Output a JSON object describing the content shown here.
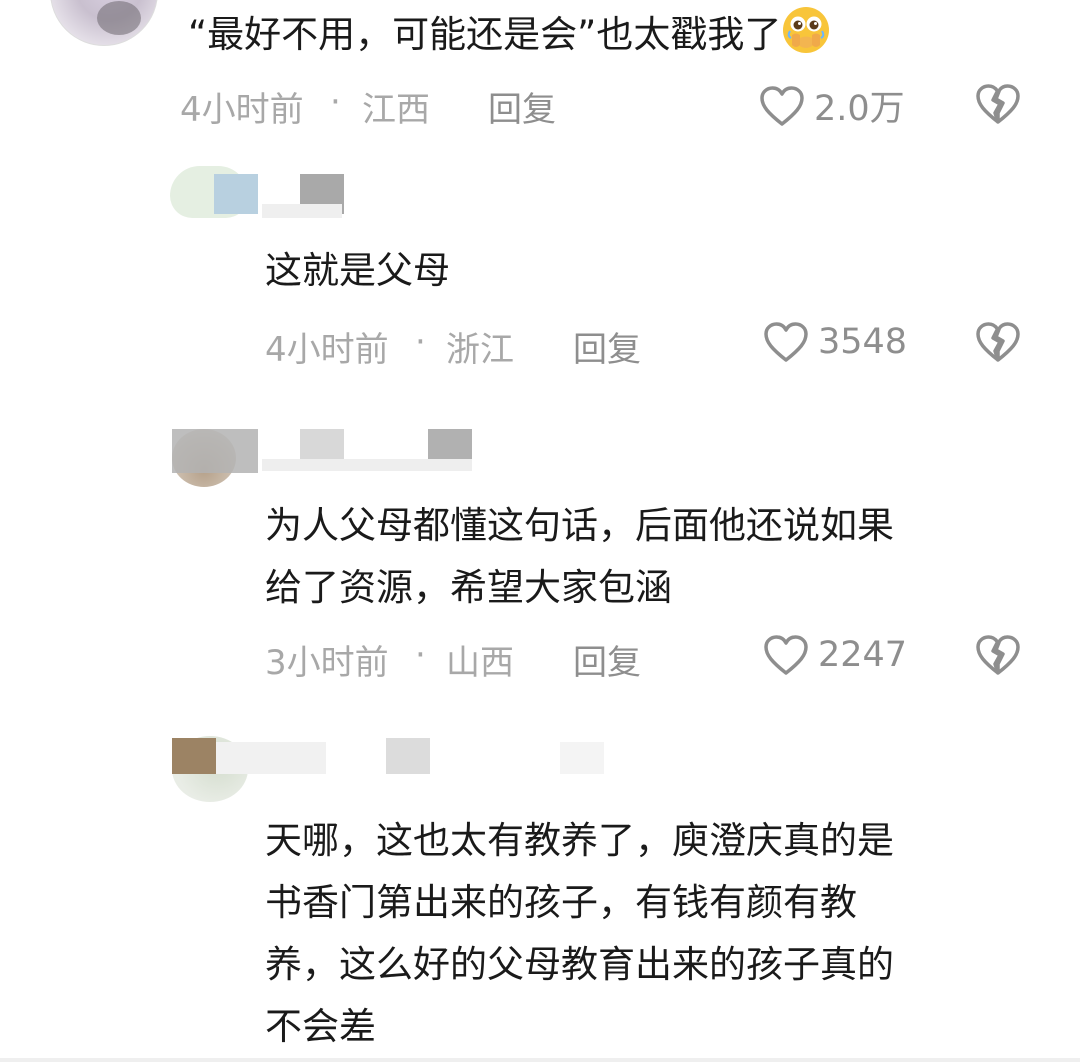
{
  "comments": [
    {
      "text": "“最好不用，可能还是会”也太戳我了",
      "emoji": "covering-mouth-teary-emoji",
      "time": "4小时前",
      "separator": "·",
      "location": "江西",
      "reply_label": "回复",
      "likes": "2.0万"
    },
    {
      "text": "这就是父母",
      "time": "4小时前",
      "separator": "·",
      "location": "浙江",
      "reply_label": "回复",
      "likes": "3548"
    },
    {
      "lines": [
        "为人父母都懂这句话，后面他还说如果",
        "给了资源，希望大家包涵"
      ],
      "time": "3小时前",
      "separator": "·",
      "location": "山西",
      "reply_label": "回复",
      "likes": "2247"
    },
    {
      "lines": [
        "天哪，这也太有教养了，庾澄庆真的是",
        "书香门第出来的孩子，有钱有颜有教",
        "养，这么好的父母教育出来的孩子真的",
        "不会差"
      ]
    }
  ],
  "icons": {
    "like": "heart-outline-icon",
    "dislike": "broken-heart-icon"
  },
  "colors": {
    "meta_text": "#a8a8a8",
    "icon_gray": "#8e8e8e",
    "body_text": "#1a1a1a"
  }
}
